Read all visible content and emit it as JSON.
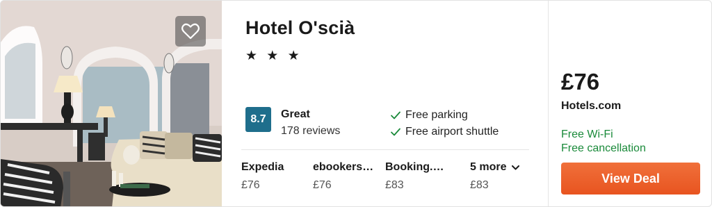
{
  "hotel": {
    "name": "Hotel O'scià",
    "stars": "★ ★ ★",
    "rating": {
      "score": "8.7",
      "label": "Great",
      "reviews": "178 reviews"
    },
    "amenities": [
      "Free parking",
      "Free airport shuttle"
    ]
  },
  "providers": [
    {
      "name": "Expedia",
      "price": "£76"
    },
    {
      "name": "ebookers…",
      "price": "£76"
    },
    {
      "name": "Booking.…",
      "price": "£83"
    }
  ],
  "more_deals": {
    "label": "5 more",
    "price": "£83",
    "icon": "chevron-down-icon"
  },
  "deal": {
    "price": "£76",
    "site": "Hotels.com",
    "perks": [
      "Free Wi-Fi",
      "Free cancellation"
    ],
    "button_label": "View Deal"
  },
  "favorite": {
    "icon": "heart-icon"
  },
  "colors": {
    "rating_badge": "#1f6e8c",
    "perk_text": "#1a8a3a",
    "deal_button": "#e85420",
    "check": "#1a8a3a"
  }
}
